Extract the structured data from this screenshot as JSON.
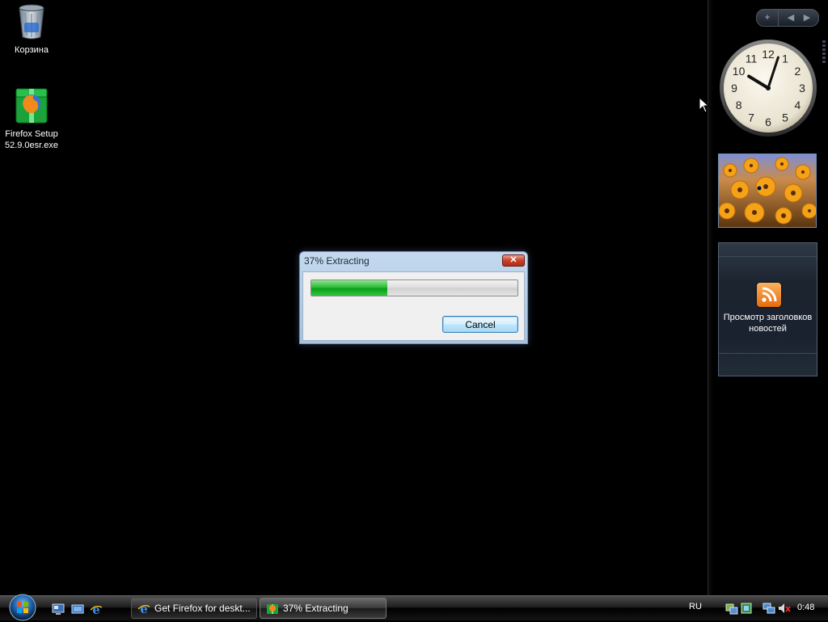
{
  "desktop": {
    "icons": [
      {
        "label": "Корзина"
      },
      {
        "label": "Firefox Setup\n52.9.0esr.exe"
      }
    ]
  },
  "sidebar": {
    "add_label": "+",
    "prev_label": "◀",
    "next_label": "▶",
    "clock": {
      "numerals": [
        "12",
        "1",
        "2",
        "3",
        "4",
        "5",
        "6",
        "7",
        "8",
        "9",
        "10",
        "11"
      ],
      "time": "10:03"
    },
    "feed": {
      "label": "Просмотр заголовков новостей"
    }
  },
  "dialog": {
    "title": "37% Extracting",
    "close_label": "✕",
    "progress": 0.37,
    "cancel_label": "Cancel"
  },
  "taskbar": {
    "tasks": [
      {
        "label": "Get Firefox for deskt..."
      },
      {
        "label": "37% Extracting"
      }
    ],
    "language": "RU",
    "time": "0:48"
  },
  "colors": {
    "progress_green": "#06a017",
    "close_red": "#c8412a",
    "rss_orange": "#e56c0a"
  }
}
